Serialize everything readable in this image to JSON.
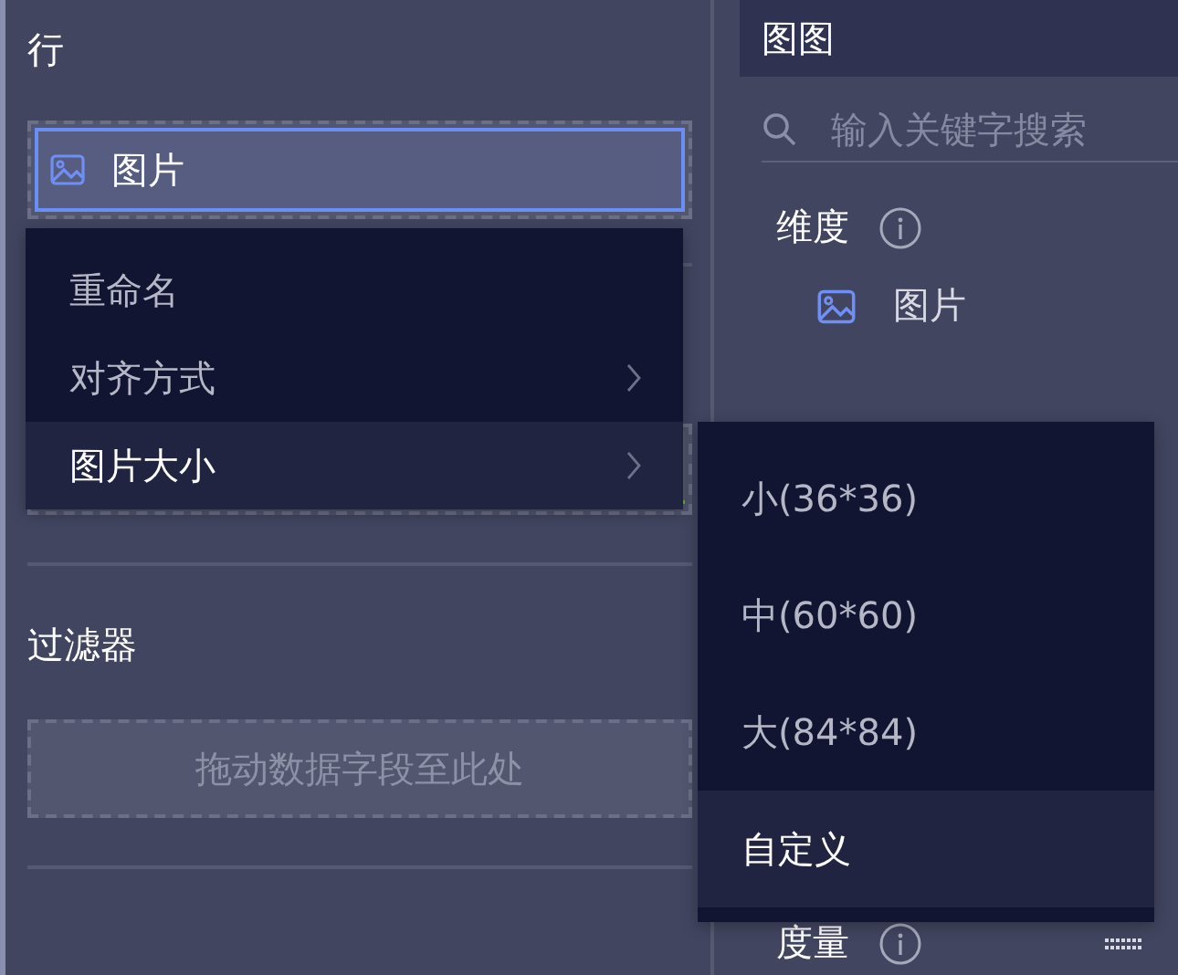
{
  "rows_section": {
    "title": "行",
    "fields": [
      {
        "label": "图片",
        "selected": true
      }
    ]
  },
  "filter_section": {
    "title": "过滤器",
    "placeholder": "拖动数据字段至此处"
  },
  "context_menu": {
    "items": [
      {
        "label": "重命名",
        "has_submenu": false,
        "selected": false
      },
      {
        "label": "对齐方式",
        "has_submenu": true,
        "selected": false
      },
      {
        "label": "图片大小",
        "has_submenu": true,
        "selected": true
      }
    ]
  },
  "submenu": {
    "items": [
      {
        "label": "小(36*36)",
        "selected": false
      },
      {
        "label": "中(60*60)",
        "selected": false
      },
      {
        "label": "大(84*84)",
        "selected": false
      },
      {
        "label": "自定义",
        "selected": true
      }
    ]
  },
  "right_panel": {
    "title": "图图",
    "search": {
      "placeholder": "输入关键字搜索"
    },
    "dimensions": {
      "title": "维度",
      "items": [
        {
          "label": "图片"
        }
      ]
    },
    "measures": {
      "title": "度量"
    }
  }
}
